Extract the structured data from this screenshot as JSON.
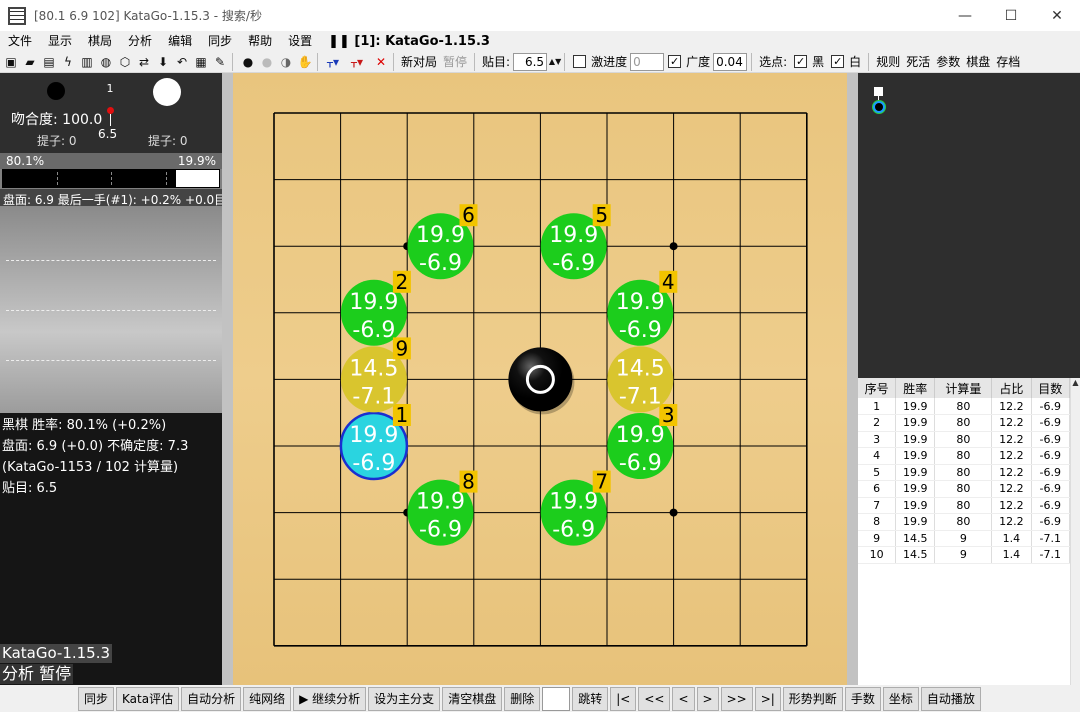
{
  "window": {
    "title": "[80.1 6.9 102] KataGo-1.15.3 - 搜索/秒",
    "minimize": "—",
    "maximize": "☐",
    "close": "✕"
  },
  "menu": {
    "items": [
      "文件",
      "显示",
      "棋局",
      "分析",
      "编辑",
      "同步",
      "帮助",
      "设置"
    ],
    "status": "❚❚ [1]: KataGo-1.15.3"
  },
  "toolbar": {
    "new_game": "新对局",
    "pause": "暂停",
    "komi_label": "贴目:",
    "komi_value": "6.5",
    "aggression_label": "激进度",
    "aggression_value": "0",
    "breadth_label": "广度",
    "breadth_value": "0.04",
    "select_label": "选点:",
    "black_label": "黑",
    "white_label": "白",
    "rules": "规则",
    "life_death": "死活",
    "params": "参数",
    "board": "棋盘",
    "save": "存档"
  },
  "left": {
    "move_number": "1",
    "match_label": "吻合度: 100.0",
    "komi": "6.5",
    "black_captures": "提子: 0",
    "white_captures": "提子: 0",
    "black_winrate": "80.1%",
    "white_winrate": "19.9%",
    "black_fraction": 0.801,
    "summary": "盘面: 6.9 最后一手(#1): +0.2% +0.0目",
    "info_lines": [
      "黑棋 胜率: 80.1% (+0.2%)",
      "盘面: 6.9 (+0.0) 不确定度: 7.3",
      "(KataGo-1153 / 102 计算量)",
      "贴目: 6.5"
    ],
    "engine_name": "KataGo-1.15.3",
    "engine_state": "分析 暂停"
  },
  "candidates": [
    {
      "rank": "1",
      "winrate": "19.9",
      "score": "-6.9",
      "col": 1,
      "row": 5,
      "color": "#2ad4e0",
      "best": true
    },
    {
      "rank": "2",
      "winrate": "19.9",
      "score": "-6.9",
      "col": 1,
      "row": 3,
      "color": "#1ccd1c"
    },
    {
      "rank": "3",
      "winrate": "19.9",
      "score": "-6.9",
      "col": 5,
      "row": 5,
      "color": "#1ccd1c"
    },
    {
      "rank": "4",
      "winrate": "19.9",
      "score": "-6.9",
      "col": 5,
      "row": 3,
      "color": "#1ccd1c"
    },
    {
      "rank": "5",
      "winrate": "19.9",
      "score": "-6.9",
      "col": 4,
      "row": 2,
      "color": "#1ccd1c"
    },
    {
      "rank": "6",
      "winrate": "19.9",
      "score": "-6.9",
      "col": 2,
      "row": 2,
      "color": "#1ccd1c"
    },
    {
      "rank": "7",
      "winrate": "19.9",
      "score": "-6.9",
      "col": 4,
      "row": 6,
      "color": "#1ccd1c"
    },
    {
      "rank": "8",
      "winrate": "19.9",
      "score": "-6.9",
      "col": 2,
      "row": 6,
      "color": "#1ccd1c"
    },
    {
      "rank": "9",
      "winrate": "14.5",
      "score": "-7.1",
      "col": 1,
      "row": 4,
      "color": "#d9c52e"
    },
    {
      "rank": "",
      "winrate": "14.5",
      "score": "-7.1",
      "col": 5,
      "row": 4,
      "color": "#d9c52e"
    }
  ],
  "table": {
    "headers": [
      "序号",
      "胜率",
      "计算量",
      "占比",
      "目数"
    ],
    "rows": [
      [
        "1",
        "19.9",
        "80",
        "12.2",
        "-6.9"
      ],
      [
        "2",
        "19.9",
        "80",
        "12.2",
        "-6.9"
      ],
      [
        "3",
        "19.9",
        "80",
        "12.2",
        "-6.9"
      ],
      [
        "4",
        "19.9",
        "80",
        "12.2",
        "-6.9"
      ],
      [
        "5",
        "19.9",
        "80",
        "12.2",
        "-6.9"
      ],
      [
        "6",
        "19.9",
        "80",
        "12.2",
        "-6.9"
      ],
      [
        "7",
        "19.9",
        "80",
        "12.2",
        "-6.9"
      ],
      [
        "8",
        "19.9",
        "80",
        "12.2",
        "-6.9"
      ],
      [
        "9",
        "14.5",
        "9",
        "1.4",
        "-7.1"
      ],
      [
        "10",
        "14.5",
        "9",
        "1.4",
        "-7.1"
      ]
    ]
  },
  "bottom": {
    "buttons": [
      "同步",
      "Kata评估",
      "自动分析",
      "纯网络",
      "▶ 继续分析",
      "设为主分支",
      "清空棋盘",
      "删除"
    ],
    "nav": [
      "跳转",
      "|<",
      "<<",
      "<",
      ">",
      ">>",
      ">|",
      "形势判断",
      "手数",
      "坐标",
      "自动播放"
    ]
  }
}
